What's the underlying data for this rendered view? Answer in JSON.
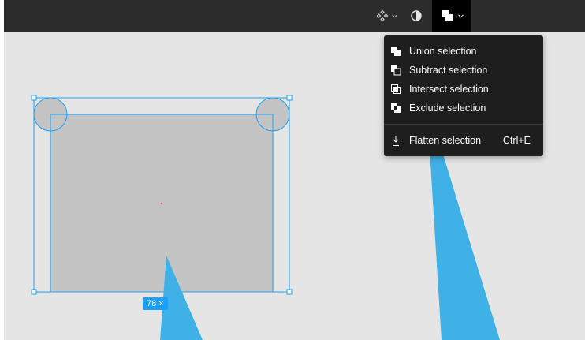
{
  "toolbar": {
    "component_icon": "component-icon",
    "mask_icon": "contrast-icon",
    "boolean_icon": "boolean-union-icon"
  },
  "boolean_menu": {
    "items": [
      {
        "label": "Union selection",
        "icon": "union-icon"
      },
      {
        "label": "Subtract selection",
        "icon": "subtract-icon"
      },
      {
        "label": "Intersect selection",
        "icon": "intersect-icon"
      },
      {
        "label": "Exclude selection",
        "icon": "exclude-icon"
      }
    ],
    "flatten": {
      "label": "Flatten selection",
      "shortcut": "Ctrl+E",
      "icon": "flatten-icon"
    }
  },
  "canvas": {
    "dimension_badge": "78 ×"
  },
  "colors": {
    "toolbar_bg": "#2c2c2c",
    "canvas_bg": "#e5e5e5",
    "menu_bg": "#1e1e1e",
    "selection_blue": "#18a0fb",
    "shape_fill": "#c4c4c4",
    "annotation_blue": "#3fb1e6"
  }
}
